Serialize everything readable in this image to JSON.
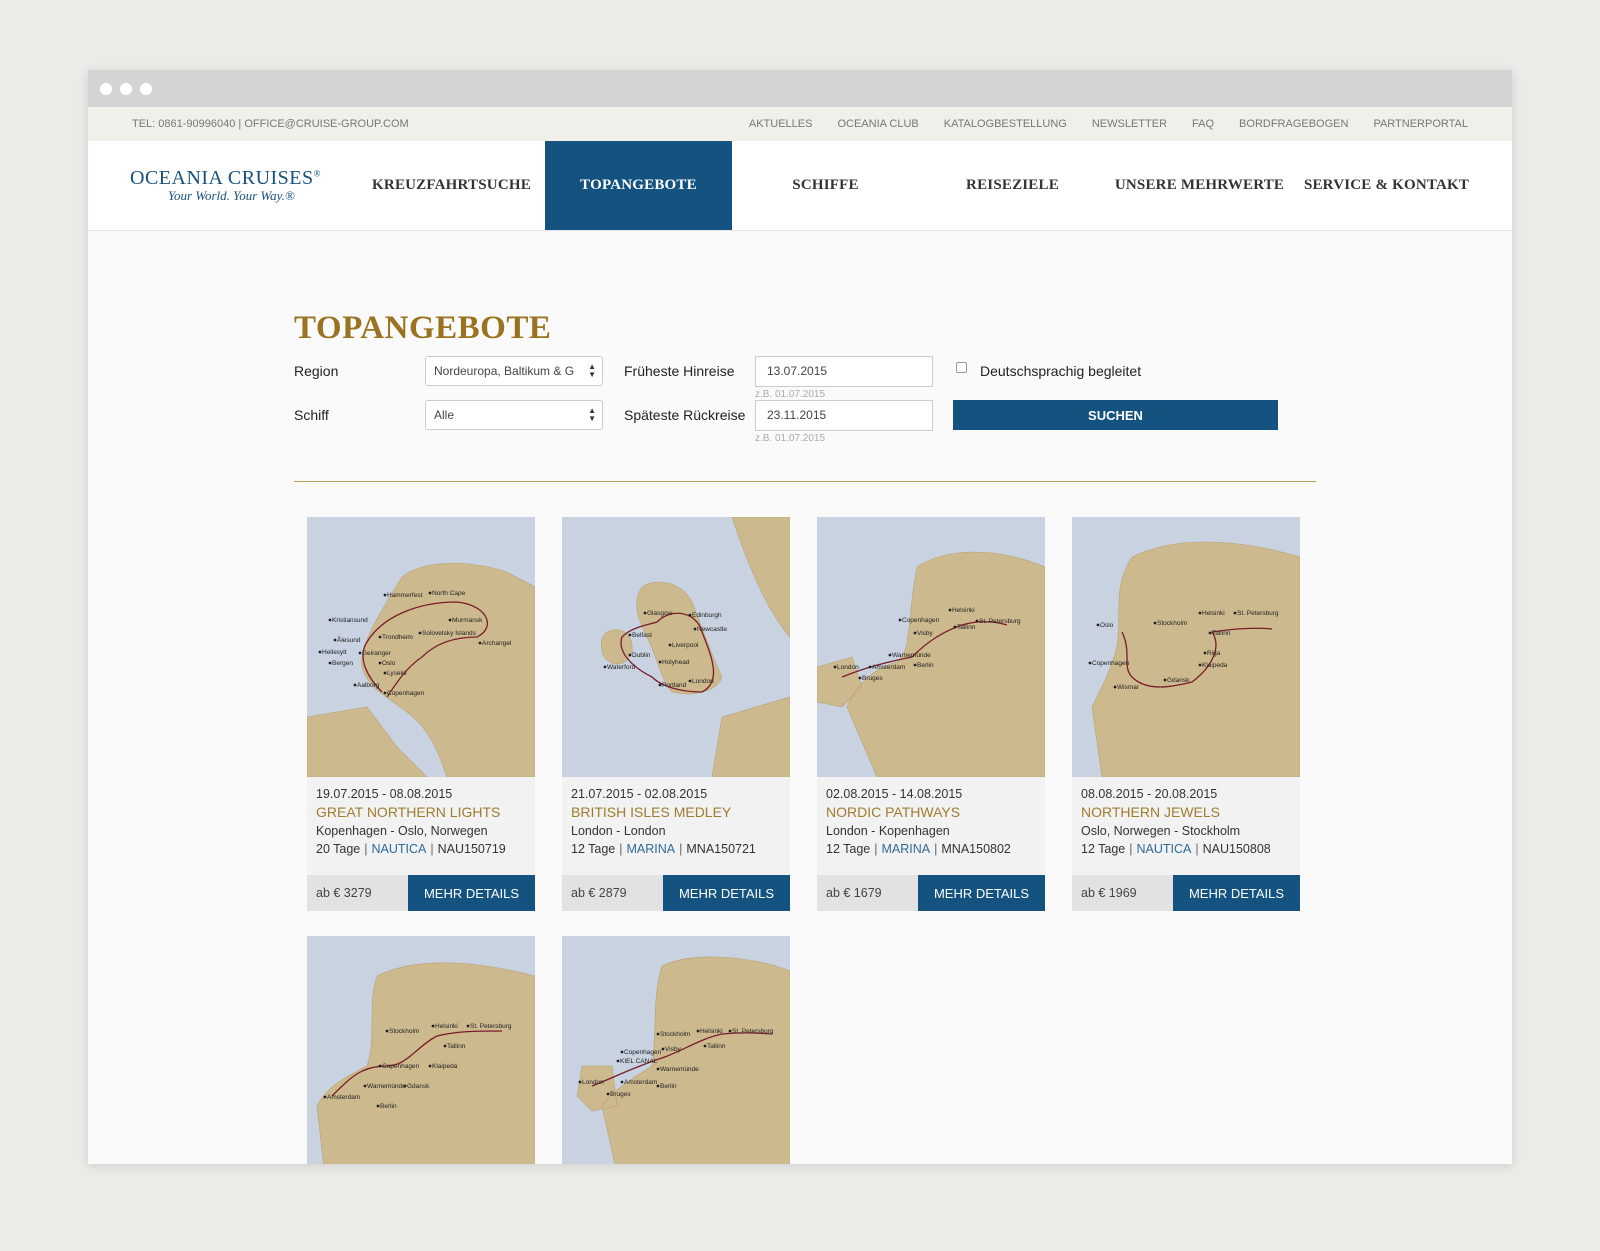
{
  "topbar": {
    "contact": "TEL: 0861-90996040 | OFFICE@CRUISE-GROUP.COM",
    "links": [
      "AKTUELLES",
      "OCEANIA CLUB",
      "KATALOGBESTELLUNG",
      "NEWSLETTER",
      "FAQ",
      "BORDFRAGEBOGEN",
      "PARTNERPORTAL"
    ]
  },
  "logo": {
    "main": "OCEANIA CRUISES",
    "reg": "®",
    "tagline": "Your World. Your Way.®"
  },
  "nav": [
    "KREUZFAHRTSUCHE",
    "TOPANGEBOTE",
    "SCHIFFE",
    "REISEZIELE",
    "UNSERE MEHRWERTE",
    "SERVICE & KONTAKT"
  ],
  "page": {
    "title": "TOPANGEBOTE"
  },
  "form": {
    "region_label": "Region",
    "region_value": "Nordeuropa, Baltikum & G",
    "ship_label": "Schiff",
    "ship_value": "Alle",
    "earliest_label": "Früheste Hinreise",
    "earliest_value": "13.07.2015",
    "earliest_hint": "z.B. 01.07.2015",
    "latest_label": "Späteste Rückreise",
    "latest_value": "23.11.2015",
    "latest_hint": "z.B. 01.07.2015",
    "german_label": "Deutschsprachig begleitet",
    "search_label": "SUCHEN"
  },
  "cards": [
    {
      "dates": "19.07.2015 - 08.08.2015",
      "title": "GREAT NORTHERN LIGHTS",
      "route": "Kopenhagen - Oslo, Norwegen",
      "days": "20 Tage",
      "ship": "NAUTICA",
      "code": "NAU150719",
      "price": "ab € 3279",
      "details": "MEHR DETAILS"
    },
    {
      "dates": "21.07.2015 - 02.08.2015",
      "title": "BRITISH ISLES MEDLEY",
      "route": "London - London",
      "days": "12 Tage",
      "ship": "MARINA",
      "code": "MNA150721",
      "price": "ab € 2879",
      "details": "MEHR DETAILS"
    },
    {
      "dates": "02.08.2015 - 14.08.2015",
      "title": "NORDIC PATHWAYS",
      "route": "London - Kopenhagen",
      "days": "12 Tage",
      "ship": "MARINA",
      "code": "MNA150802",
      "price": "ab € 1679",
      "details": "MEHR DETAILS"
    },
    {
      "dates": "08.08.2015 - 20.08.2015",
      "title": "NORTHERN JEWELS",
      "route": "Oslo, Norwegen - Stockholm",
      "days": "12 Tage",
      "ship": "NAUTICA",
      "code": "NAU150808",
      "price": "ab € 1969",
      "details": "MEHR DETAILS"
    }
  ],
  "maps": [
    {
      "labels": [
        "Hammerfest",
        "North Cape",
        "Kristiansund",
        "Murmansk",
        "Ålesund",
        "Trondheim",
        "Solovetsky Islands",
        "Hellesylt",
        "Geiranger",
        "Archangel",
        "Bergen",
        "Oslo",
        "Lysekil",
        "Aalborg",
        "Copenhagen"
      ]
    },
    {
      "labels": [
        "Glasgow",
        "Edinburgh",
        "Newcastle",
        "Belfast",
        "Liverpool",
        "Dublin",
        "Holyhead",
        "Waterford",
        "Portland",
        "London"
      ]
    },
    {
      "labels": [
        "Helsinki",
        "St. Petersburg",
        "Copenhagen",
        "Visby",
        "Tallinn",
        "Warnemünde",
        "London",
        "Amsterdam",
        "Berlin",
        "Bruges"
      ]
    },
    {
      "labels": [
        "Oslo",
        "Stockholm",
        "Helsinki",
        "St. Petersburg",
        "Tallinn",
        "Copenhagen",
        "Riga",
        "Klaipeda",
        "Gdansk",
        "Wismar"
      ]
    },
    {
      "labels": [
        "Stockholm",
        "Helsinki",
        "St. Petersburg",
        "Tallinn",
        "Copenhagen",
        "Klaipeda",
        "Warnemünde",
        "Gdansk",
        "Amsterdam",
        "Berlin"
      ]
    },
    {
      "labels": [
        "Stockholm",
        "Helsinki",
        "St. Petersburg",
        "Copenhagen",
        "Visby",
        "Tallinn",
        "KIEL CANAL",
        "London",
        "Warnemünde",
        "Amsterdam",
        "Berlin",
        "Bruges"
      ]
    }
  ]
}
